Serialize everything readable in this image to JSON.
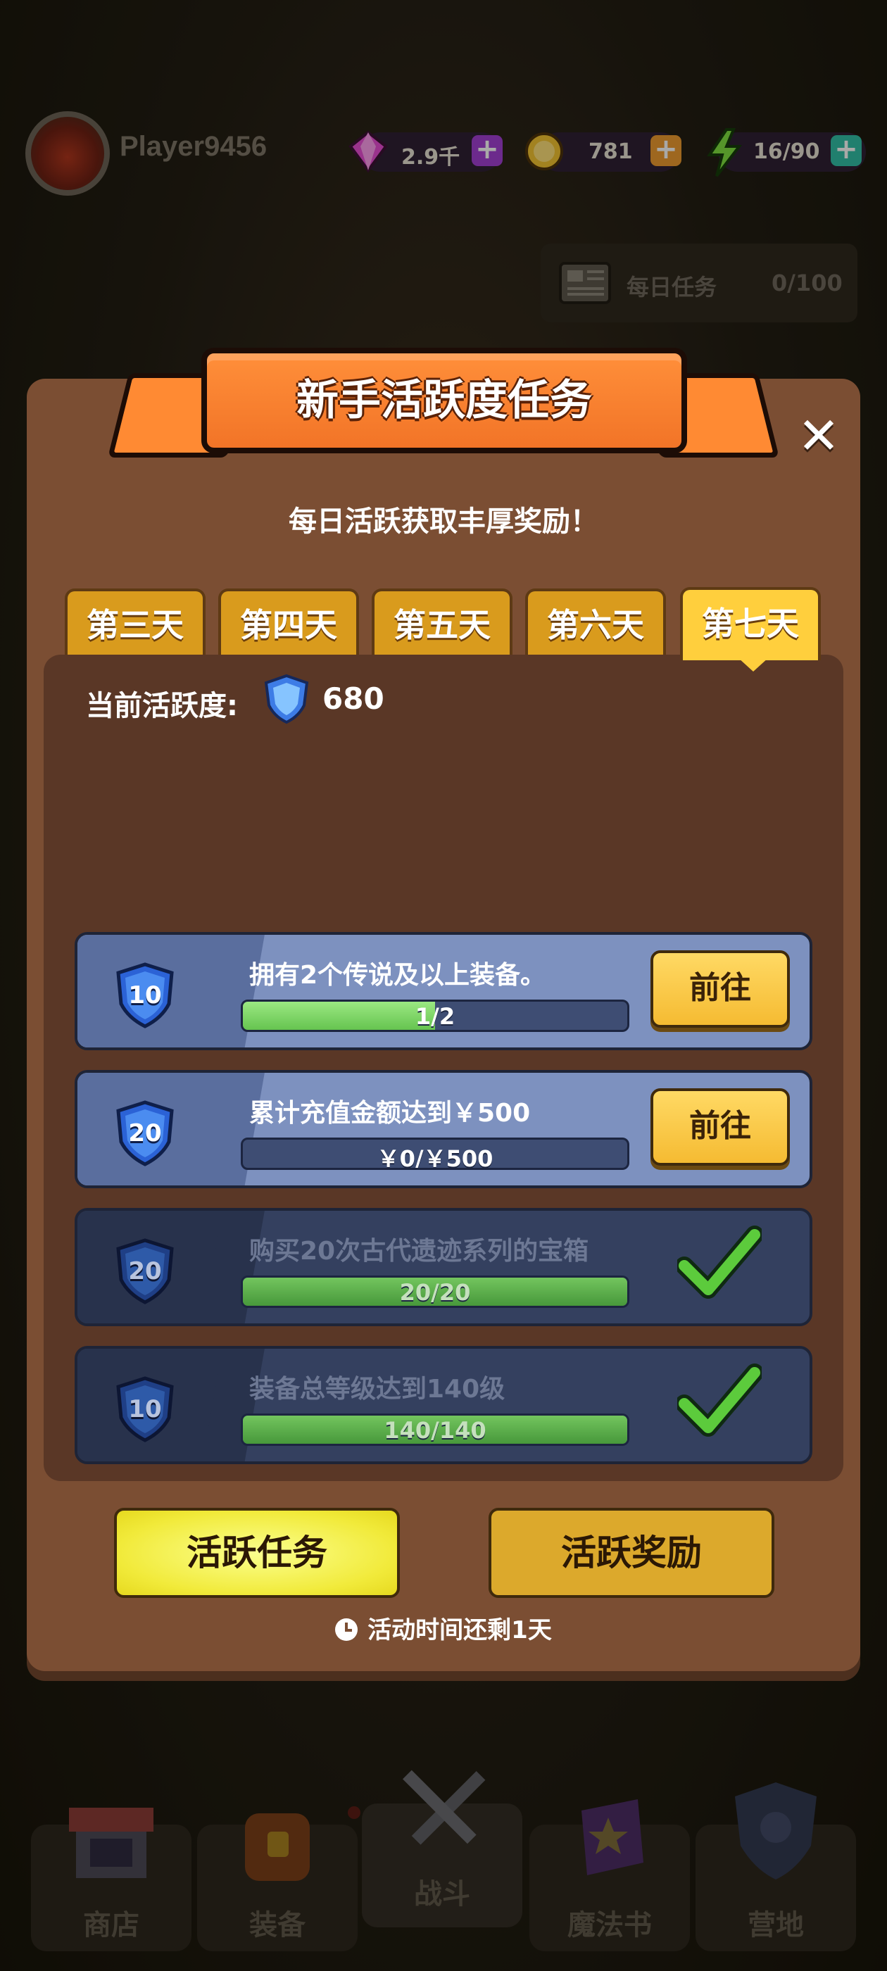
{
  "hud": {
    "player_name": "Player9456",
    "gems": "2.9千",
    "coins": "781",
    "energy": "16/90",
    "daily_tasks_label": "每日任务",
    "daily_tasks_count": "0/100"
  },
  "bottom_nav": {
    "items": [
      {
        "label": "商店",
        "icon": "shop-icon"
      },
      {
        "label": "装备",
        "icon": "backpack-icon"
      },
      {
        "label": "战斗",
        "icon": "crossed-swords-icon"
      },
      {
        "label": "魔法书",
        "icon": "spellbook-icon"
      },
      {
        "label": "营地",
        "icon": "camp-shield-icon"
      }
    ]
  },
  "modal": {
    "title": "新手活跃度任务",
    "subtitle": "每日活跃获取丰厚奖励！",
    "tabs": [
      "第三天",
      "第四天",
      "第五天",
      "第六天",
      "第七天"
    ],
    "active_tab": "第七天",
    "activity_label": "当前活跃度:",
    "activity_value": "680",
    "tasks": [
      {
        "points": "10",
        "desc": "拥有2个传说及以上装备。",
        "progress_text": "1/2",
        "progress": 0.5,
        "state": "open",
        "button": "前往"
      },
      {
        "points": "20",
        "desc": "累计充值金额达到￥500",
        "progress_text": "￥0/￥500",
        "progress": 0,
        "state": "open",
        "button": "前往"
      },
      {
        "points": "20",
        "desc": "购买20次古代遗迹系列的宝箱",
        "progress_text": "20/20",
        "progress": 1,
        "state": "done"
      },
      {
        "points": "10",
        "desc": "装备总等级达到140级",
        "progress_text": "140/140",
        "progress": 1,
        "state": "done"
      }
    ],
    "button_active_tasks": "活跃任务",
    "button_active_rewards": "活跃奖励",
    "time_remaining": "活动时间还剩1天"
  },
  "colors": {
    "modal_bg": "#7b4e33",
    "banner": "#ff8a33",
    "tab": "#d99b1d",
    "tab_active": "#ffcf3d",
    "task_open": "#7d91bf",
    "task_done": "#34405f",
    "progress_green": "#66c450",
    "go_button": "#f5bb32"
  }
}
